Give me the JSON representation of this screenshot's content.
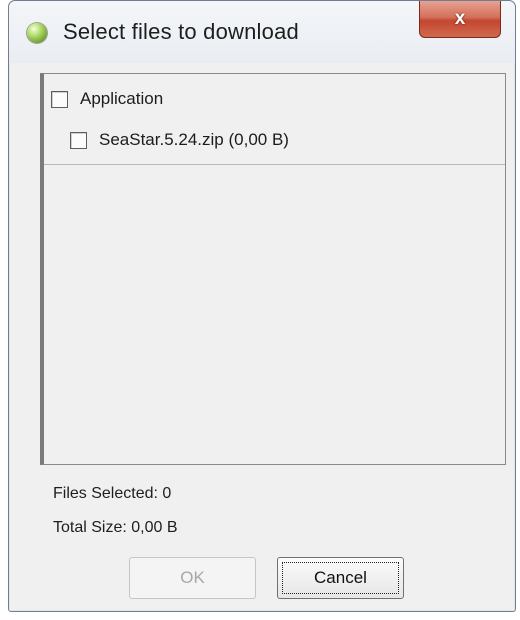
{
  "window": {
    "title": "Select files to download",
    "close_label": "x"
  },
  "file_list": {
    "group": {
      "label": "Application",
      "checked": false
    },
    "files": [
      {
        "label": "SeaStar.5.24.zip (0,00 B)",
        "checked": false
      }
    ]
  },
  "summary": {
    "files_selected": "Files Selected: 0",
    "total_size": "Total Size: 0,00 B"
  },
  "buttons": {
    "ok_label": "OK",
    "ok_enabled": false,
    "cancel_label": "Cancel"
  },
  "colors": {
    "close_button": "#c4462e",
    "dialog_background": "#f0f0f0"
  }
}
